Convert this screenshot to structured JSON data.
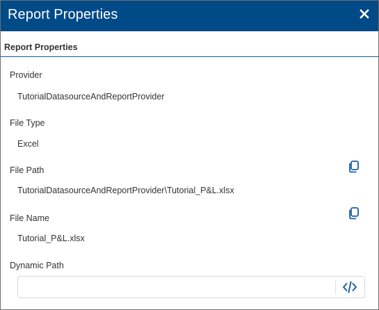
{
  "window": {
    "title": "Report Properties",
    "close_icon": "close-icon"
  },
  "section": {
    "header": "Report Properties"
  },
  "fields": {
    "provider": {
      "label": "Provider",
      "value": "TutorialDatasourceAndReportProvider"
    },
    "file_type": {
      "label": "File Type",
      "value": "Excel"
    },
    "file_path": {
      "label": "File Path",
      "value": "TutorialDatasourceAndReportProvider\\Tutorial_P&L.xlsx",
      "action_icon": "copy-icon"
    },
    "file_name": {
      "label": "File Name",
      "value": "Tutorial_P&L.xlsx",
      "action_icon": "copy-icon"
    },
    "dynamic_path": {
      "label": "Dynamic Path",
      "value": "",
      "action_icon": "code-icon"
    }
  },
  "colors": {
    "title_bar": "#004a87",
    "accent": "#1a5ea8",
    "text": "#333333"
  }
}
